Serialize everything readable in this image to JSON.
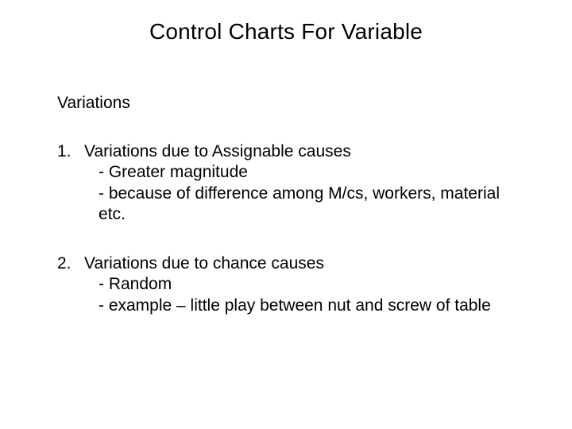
{
  "title": "Control Charts For Variable",
  "section": "Variations",
  "items": [
    {
      "num": "1.",
      "head": "Variations due to Assignable causes",
      "sub1": "- Greater magnitude",
      "sub2": "- because of difference among M/cs, workers, material etc."
    },
    {
      "num": "2.",
      "head": "Variations due to chance causes",
      "sub1": "- Random",
      "sub2": "- example – little play between nut and screw of table"
    }
  ]
}
